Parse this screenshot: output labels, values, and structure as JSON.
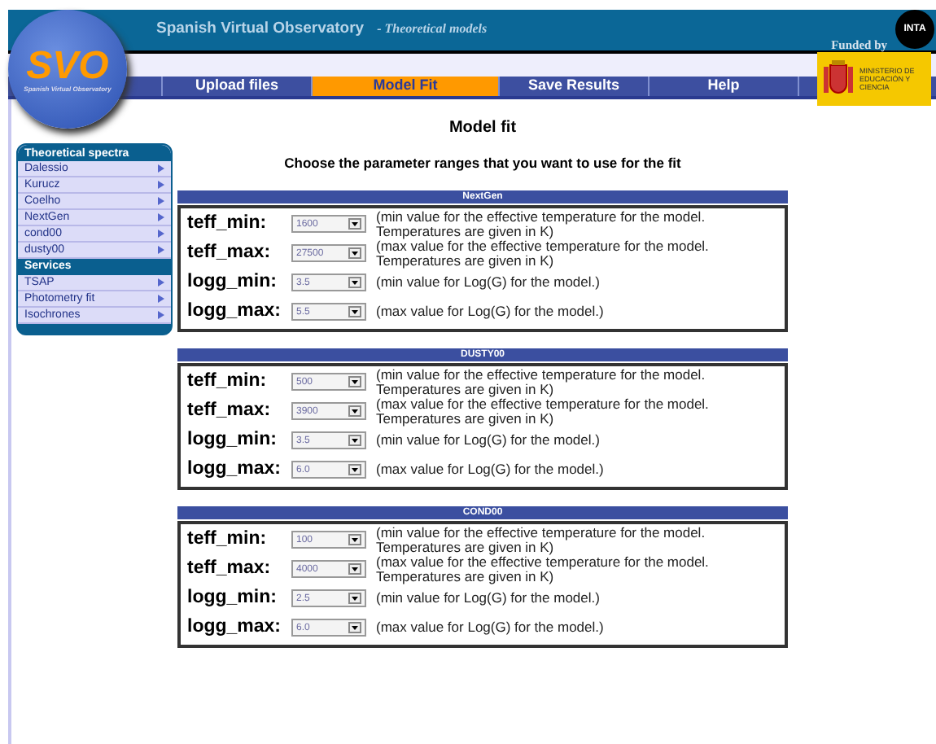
{
  "logo": {
    "text": "SVO",
    "subtitle": "Spanish Virtual Observatory"
  },
  "header": {
    "title": "Spanish Virtual Observatory",
    "subtitle": "- Theoretical models",
    "funded_by": "Funded by",
    "inta": "INTA",
    "ministry": "MINISTERIO DE EDUCACIÓN Y CIENCIA"
  },
  "tabs": [
    {
      "label": "Upload files",
      "selected": false
    },
    {
      "label": "Model Fit",
      "selected": true
    },
    {
      "label": "Save Results",
      "selected": false
    },
    {
      "label": "Help",
      "selected": false
    }
  ],
  "sidebar": {
    "items": [
      {
        "kind": "header",
        "label": "Theoretical spectra"
      },
      {
        "kind": "link",
        "label": "Dalessio"
      },
      {
        "kind": "link",
        "label": "Kurucz"
      },
      {
        "kind": "link",
        "label": "Coelho"
      },
      {
        "kind": "link",
        "label": "NextGen"
      },
      {
        "kind": "link",
        "label": "cond00"
      },
      {
        "kind": "link",
        "label": "dusty00"
      },
      {
        "kind": "section",
        "label": "Services"
      },
      {
        "kind": "link",
        "label": "TSAP"
      },
      {
        "kind": "link",
        "label": "Photometry fit"
      },
      {
        "kind": "link",
        "label": "Isochrones"
      }
    ]
  },
  "main": {
    "title": "Model fit",
    "subtitle": "Choose the parameter ranges that you want to use for the fit",
    "sections": [
      {
        "title": "NextGen",
        "params": [
          {
            "label": "teff_min:",
            "value": "1600",
            "description": "(min value for the effective temperature for the model. Temperatures are given in K)"
          },
          {
            "label": "teff_max:",
            "value": "27500",
            "description": "(max value for the effective temperature for the model. Temperatures are given in K)"
          },
          {
            "label": "logg_min:",
            "value": "3.5",
            "description": "(min value for Log(G) for the model.)"
          },
          {
            "label": "logg_max:",
            "value": "5.5",
            "description": "(max value for Log(G) for the model.)"
          }
        ]
      },
      {
        "title": "DUSTY00",
        "params": [
          {
            "label": "teff_min:",
            "value": "500",
            "description": "(min value for the effective temperature for the model. Temperatures are given in K)"
          },
          {
            "label": "teff_max:",
            "value": "3900",
            "description": "(max value for the effective temperature for the model. Temperatures are given in K)"
          },
          {
            "label": "logg_min:",
            "value": "3.5",
            "description": "(min value for Log(G) for the model.)"
          },
          {
            "label": "logg_max:",
            "value": "6.0",
            "description": "(max value for Log(G) for the model.)"
          }
        ]
      },
      {
        "title": "COND00",
        "params": [
          {
            "label": "teff_min:",
            "value": "100",
            "description": "(min value for the effective temperature for the model. Temperatures are given in K)"
          },
          {
            "label": "teff_max:",
            "value": "4000",
            "description": "(max value for the effective temperature for the model. Temperatures are given in K)"
          },
          {
            "label": "logg_min:",
            "value": "2.5",
            "description": "(min value for Log(G) for the model.)"
          },
          {
            "label": "logg_max:",
            "value": "6.0",
            "description": "(max value for Log(G) for the model.)"
          }
        ]
      }
    ]
  }
}
